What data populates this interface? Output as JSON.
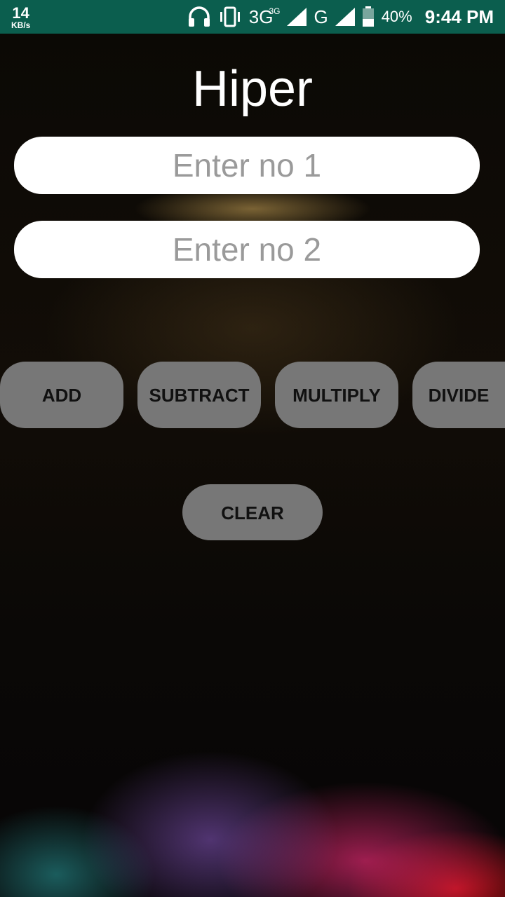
{
  "status_bar": {
    "speed_value": "14",
    "speed_unit": "KB/s",
    "network_primary": "3G",
    "network_super": "3G",
    "network_secondary": "G",
    "battery_percent": "40%",
    "time": "9:44 PM"
  },
  "app": {
    "title": "Hiper",
    "input1_placeholder": "Enter no 1",
    "input2_placeholder": "Enter no 2",
    "buttons": {
      "add": "ADD",
      "subtract": "SUBTRACT",
      "multiply": "MULTIPLY",
      "divide": "DIVIDE",
      "clear": "CLEAR"
    }
  },
  "colors": {
    "status_bar": "#0b5e4e",
    "button_bg": "#777777",
    "field_bg": "#ffffff"
  }
}
